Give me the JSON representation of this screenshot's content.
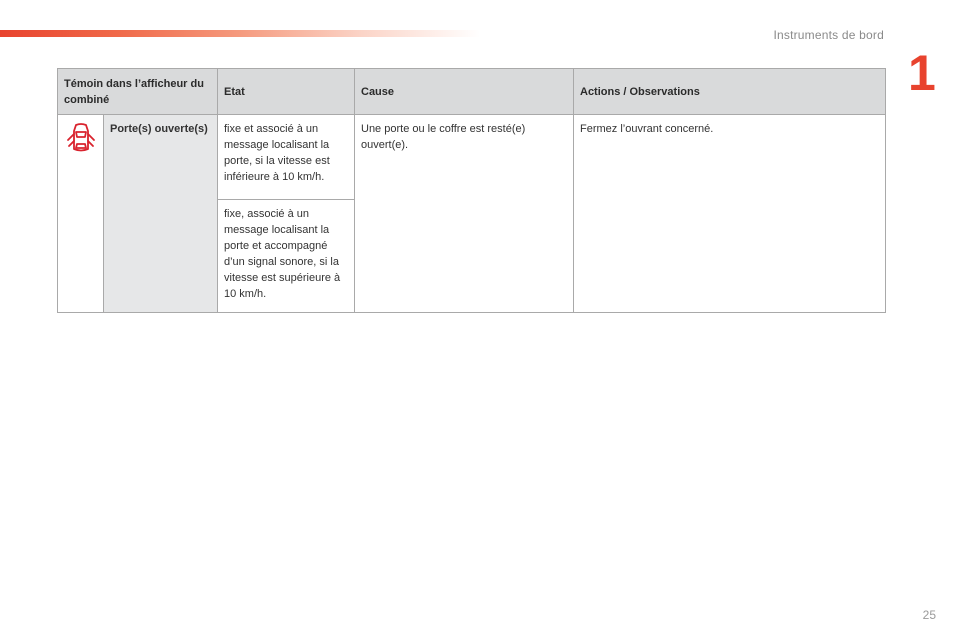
{
  "header": {
    "section_title": "Instruments de bord",
    "chapter_number": "1",
    "accent_color": "#e8432e"
  },
  "table": {
    "headers": {
      "temoin": "Témoin dans l’afficheur du combiné",
      "etat": "Etat",
      "cause": "Cause",
      "actions": "Actions / Observations"
    },
    "rows": [
      {
        "icon": "car-door-open-icon",
        "icon_color": "#d9232e",
        "name": "Porte(s) ouverte(s)",
        "etats": [
          "fixe et associé à un message localisant la porte, si la vitesse est inférieure à 10 km/h.",
          "fixe, associé à un message localisant la porte et accompagné d’un signal sonore, si la vitesse est supérieure à 10 km/h."
        ],
        "cause": "Une porte ou le coffre est resté(e) ouvert(e).",
        "actions": "Fermez l’ouvrant concerné."
      }
    ]
  },
  "footer": {
    "page_number": "25"
  }
}
